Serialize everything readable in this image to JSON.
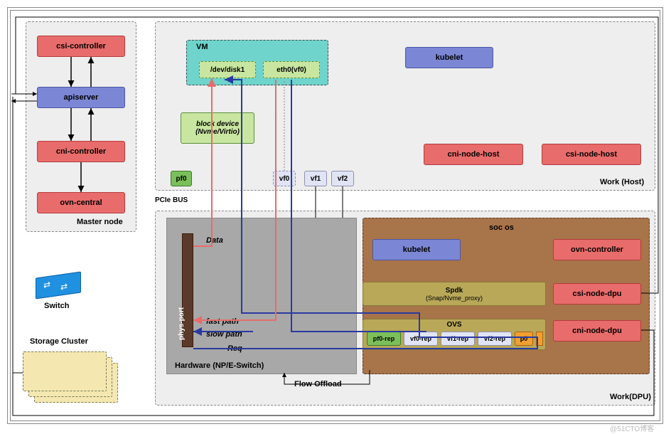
{
  "master": {
    "title": "Master node",
    "csi_controller": "csi-controller",
    "apiserver": "apiserver",
    "cni_controller": "cni-controller",
    "ovn_central": "ovn-central"
  },
  "switch": {
    "label": "Switch"
  },
  "storage": {
    "label": "Storage Cluster"
  },
  "work_host": {
    "title": "Work (Host)",
    "vm": {
      "title": "VM",
      "disk": "/dev/disk1",
      "eth": "eth0(vf0)"
    },
    "block": "block device\n(Nvme/Virtio)",
    "kubelet": "kubelet",
    "cni_node": "cni-node-host",
    "csi_node": "csi-node-host",
    "pf0": "pf0",
    "vf0": "vf0",
    "vf1": "vf1",
    "vf2": "vf2",
    "pcie": "PCIe BUS"
  },
  "work_dpu": {
    "title": "Work(DPU)",
    "hardware_label": "Hardware   (NP/E-Switch)",
    "phys_port": "phys-port",
    "data_label": "Data",
    "fast_path": "fast path",
    "slow_path": "slow path",
    "req_label": "Req",
    "flow_offload": "Flow Offload",
    "soc": {
      "title": "soc os",
      "kubelet": "kubelet",
      "ovn_controller": "ovn-controller",
      "csi_node": "csi-node-dpu",
      "cni_node": "cni-node-dpu",
      "spdk": "Spdk",
      "spdk_sub": "(Snap/Nvme_proxy)",
      "ovs": "OVS",
      "pf0rep": "pf0-rep",
      "vf0rep": "vf0-rep",
      "vf1rep": "vf1-rep",
      "vf2rep": "vf2-rep",
      "p0": "p0"
    }
  },
  "watermark": "@51CTO博客"
}
